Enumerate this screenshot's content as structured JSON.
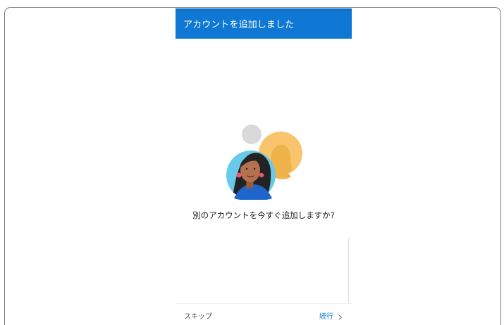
{
  "screen": {
    "header": {
      "title": "アカウントを追加しました"
    },
    "prompt": {
      "question": "別のアカウントを今すぐ追加しますか?"
    },
    "footer": {
      "skip_label": "スキップ",
      "continue_label": "続行"
    },
    "icons": {
      "profile_illustration": "profile-avatars-illustration",
      "continue_arrow": "chevron-right-icon"
    },
    "colors": {
      "accent": "#0f78d4",
      "avatar_blue": "#69c9ea",
      "avatar_orange": "#f8c56d",
      "gray_circle": "#d9d9d9"
    }
  }
}
